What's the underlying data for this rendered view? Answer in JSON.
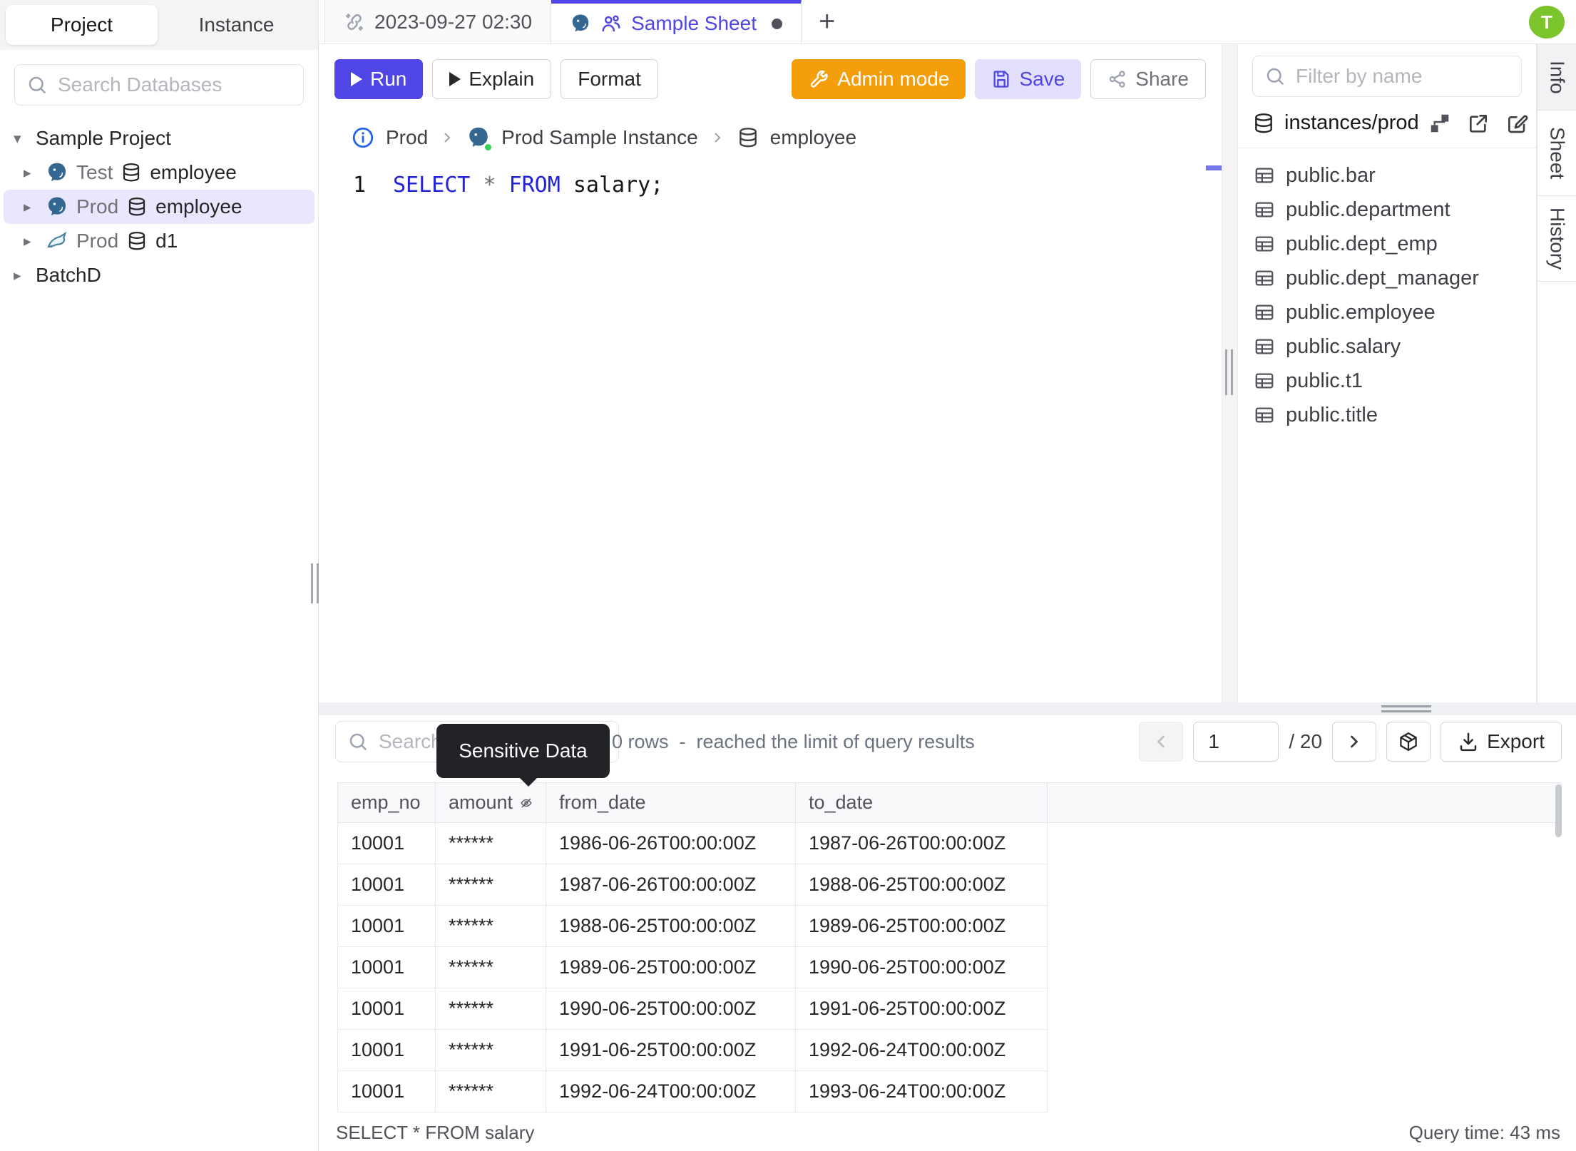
{
  "topbar": {
    "editor_tabs": [
      {
        "label": "2023-09-27 02:30",
        "active": false
      },
      {
        "label": "Sample Sheet",
        "active": true
      }
    ],
    "new_tab_label": "+",
    "avatar_initial": "T"
  },
  "left_sidebar": {
    "tabs": {
      "project": "Project",
      "instance": "Instance"
    },
    "search_placeholder": "Search Databases",
    "tree": [
      {
        "type": "project",
        "label": "Sample Project",
        "expanded": true
      },
      {
        "type": "database",
        "engine": "postgres",
        "environment": "Test",
        "name": "employee",
        "selected": false
      },
      {
        "type": "database",
        "engine": "postgres",
        "environment": "Prod",
        "name": "employee",
        "selected": true
      },
      {
        "type": "database",
        "engine": "mysql",
        "environment": "Prod",
        "name": "d1",
        "selected": false
      },
      {
        "type": "project",
        "label": "BatchD",
        "expanded": false
      }
    ]
  },
  "toolbar": {
    "run": "Run",
    "explain": "Explain",
    "format": "Format",
    "admin_mode": "Admin mode",
    "save": "Save",
    "share": "Share"
  },
  "breadcrumb": {
    "environment": "Prod",
    "instance": "Prod Sample Instance",
    "database": "employee"
  },
  "editor": {
    "line_number": "1",
    "tokens": [
      {
        "text": "SELECT ",
        "type": "keyword"
      },
      {
        "text": "* ",
        "type": "operator"
      },
      {
        "text": "FROM ",
        "type": "keyword"
      },
      {
        "text": "salary;",
        "type": "identifier"
      }
    ]
  },
  "schema_panel": {
    "filter_placeholder": "Filter by name",
    "title": "instances/prod",
    "tables": [
      "public.bar",
      "public.department",
      "public.dept_emp",
      "public.dept_manager",
      "public.employee",
      "public.salary",
      "public.t1",
      "public.title"
    ]
  },
  "side_tabs": [
    {
      "label": "Info",
      "active": true
    },
    {
      "label": "Sheet",
      "active": false
    },
    {
      "label": "History",
      "active": false
    }
  ],
  "results": {
    "search_placeholder": "Search",
    "tooltip": "Sensitive Data",
    "summary": "0 rows  -  reached the limit of query results",
    "page": "1",
    "page_total": "/ 20",
    "export_label": "Export",
    "columns": [
      {
        "name": "emp_no",
        "masked": false
      },
      {
        "name": "amount",
        "masked": true
      },
      {
        "name": "from_date",
        "masked": false
      },
      {
        "name": "to_date",
        "masked": false
      }
    ],
    "rows": [
      [
        "10001",
        "******",
        "1986-06-26T00:00:00Z",
        "1987-06-26T00:00:00Z"
      ],
      [
        "10001",
        "******",
        "1987-06-26T00:00:00Z",
        "1988-06-25T00:00:00Z"
      ],
      [
        "10001",
        "******",
        "1988-06-25T00:00:00Z",
        "1989-06-25T00:00:00Z"
      ],
      [
        "10001",
        "******",
        "1989-06-25T00:00:00Z",
        "1990-06-25T00:00:00Z"
      ],
      [
        "10001",
        "******",
        "1990-06-25T00:00:00Z",
        "1991-06-25T00:00:00Z"
      ],
      [
        "10001",
        "******",
        "1991-06-25T00:00:00Z",
        "1992-06-24T00:00:00Z"
      ],
      [
        "10001",
        "******",
        "1992-06-24T00:00:00Z",
        "1993-06-24T00:00:00Z"
      ]
    ],
    "statement": "SELECT * FROM salary",
    "query_time": "Query time: 43 ms"
  },
  "colors": {
    "accent": "#4f46e5",
    "admin_orange": "#f59e0b",
    "save_bg": "#e2e0fc",
    "avatar_green": "#7bc42c",
    "keyword_blue": "#2222dd",
    "tooltip_bg": "#212327",
    "selected_row_bg": "#e9e7fd"
  }
}
